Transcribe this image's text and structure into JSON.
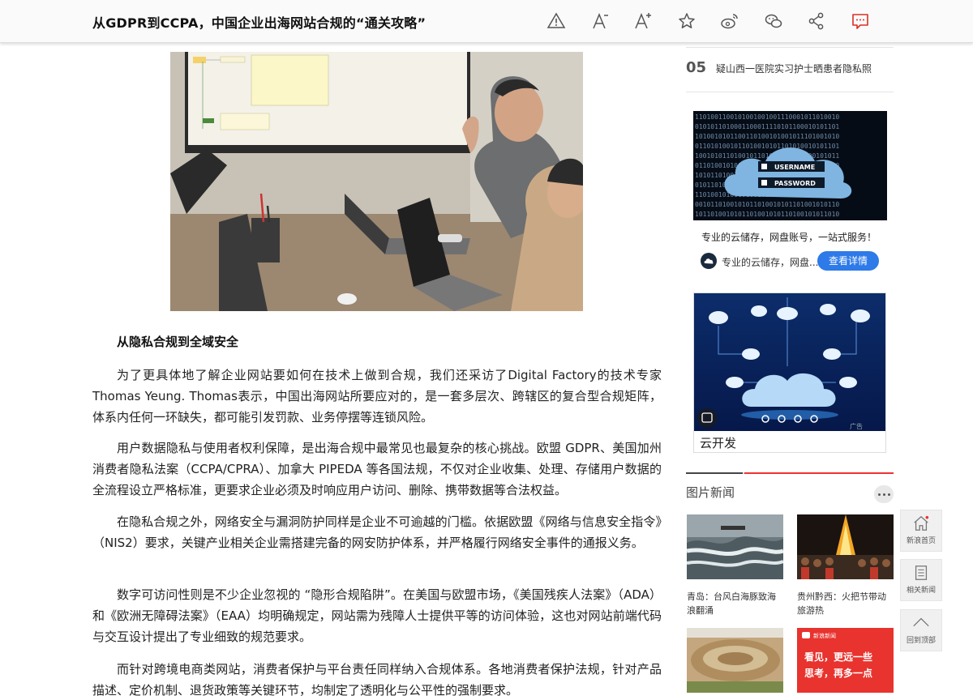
{
  "header": {
    "title": "从GDPR到CCPA，中国企业出海网站合规的“通关攻略”",
    "tools": [
      "warning-icon",
      "font-smaller-icon",
      "font-larger-icon",
      "favorite-star-icon",
      "weibo-icon",
      "wechat-icon",
      "share-icon",
      "comment-icon"
    ]
  },
  "article": {
    "section_heading": "从隐私合规到全域安全",
    "paragraphs": [
      "为了更具体地了解企业网站要如何在技术上做到合规，我们还采访了Digital Factory的技术专家Thomas Yeung. Thomas表示，中国出海网站所要应对的，是一套多层次、跨辖区的复合型合规矩阵，体系内任何一环缺失，都可能引发罚款、业务停摆等连锁风险。",
      "用户数据隐私与使用者权利保障，是出海合规中最常见也最复杂的核心挑战。欧盟 GDPR、美国加州消费者隐私法案（CCPA/CPRA）、加拿大 PIPEDA 等各国法规，不仅对企业收集、处理、存储用户数据的全流程设立严格标准，更要求企业必须及时响应用户访问、删除、携带数据等合法权益。",
      "在隐私合规之外，网络安全与漏洞防护同样是企业不可逾越的门槛。依据欧盟《网络与信息安全指令》（NIS2）要求，关键产业相关企业需搭建完备的网安防护体系，并严格履行网络安全事件的通报义务。",
      "数字可访问性则是不少企业忽视的 “隐形合规陷阱”。在美国与欧盟市场，《美国残疾人法案》（ADA）和《欧洲无障碍法案》（EAA）均明确规定，网站需为残障人士提供平等的访问体验，这也对网站前端代码与交互设计提出了专业细致的规范要求。",
      "而针对跨境电商类网站，消费者保护与平台责任同样纳入合规体系。各地消费者保护法规，针对产品描述、定价机制、退货政策等关键环节，均制定了透明化与公平性的强制要求。"
    ]
  },
  "sidebar": {
    "rank_item": {
      "num": "05",
      "text": "疑山西一医院实习护士晒患者隐私照"
    },
    "ad1": {
      "username_label": "USERNAME",
      "password_label": "PASSWORD",
      "title": "专业的云储存，网盘账号，一站式服务！",
      "sub": "专业的云储存，网盘...",
      "button": "查看详情"
    },
    "ad2": {
      "caption": "云开发",
      "ad_label": "广告"
    },
    "pic_news": {
      "heading": "图片新闻",
      "items": [
        {
          "caption": "青岛：台风白海豚致海浪翻涌"
        },
        {
          "caption": "贵州黔西：火把节带动旅游热"
        },
        {
          "caption": ""
        },
        {
          "caption": "",
          "ad_text_1": "看见，更远一些",
          "ad_text_2": "思考，再多一点",
          "ad_brand": "新浪新闻"
        }
      ]
    }
  },
  "side_nav": [
    {
      "label": "新浪首页",
      "icon": "home-icon"
    },
    {
      "label": "相关新闻",
      "icon": "document-icon"
    },
    {
      "label": "回到顶部",
      "icon": "arrow-up-icon"
    }
  ],
  "colors": {
    "accent_blue": "#2d7ae8",
    "accent_red": "#e33333"
  }
}
